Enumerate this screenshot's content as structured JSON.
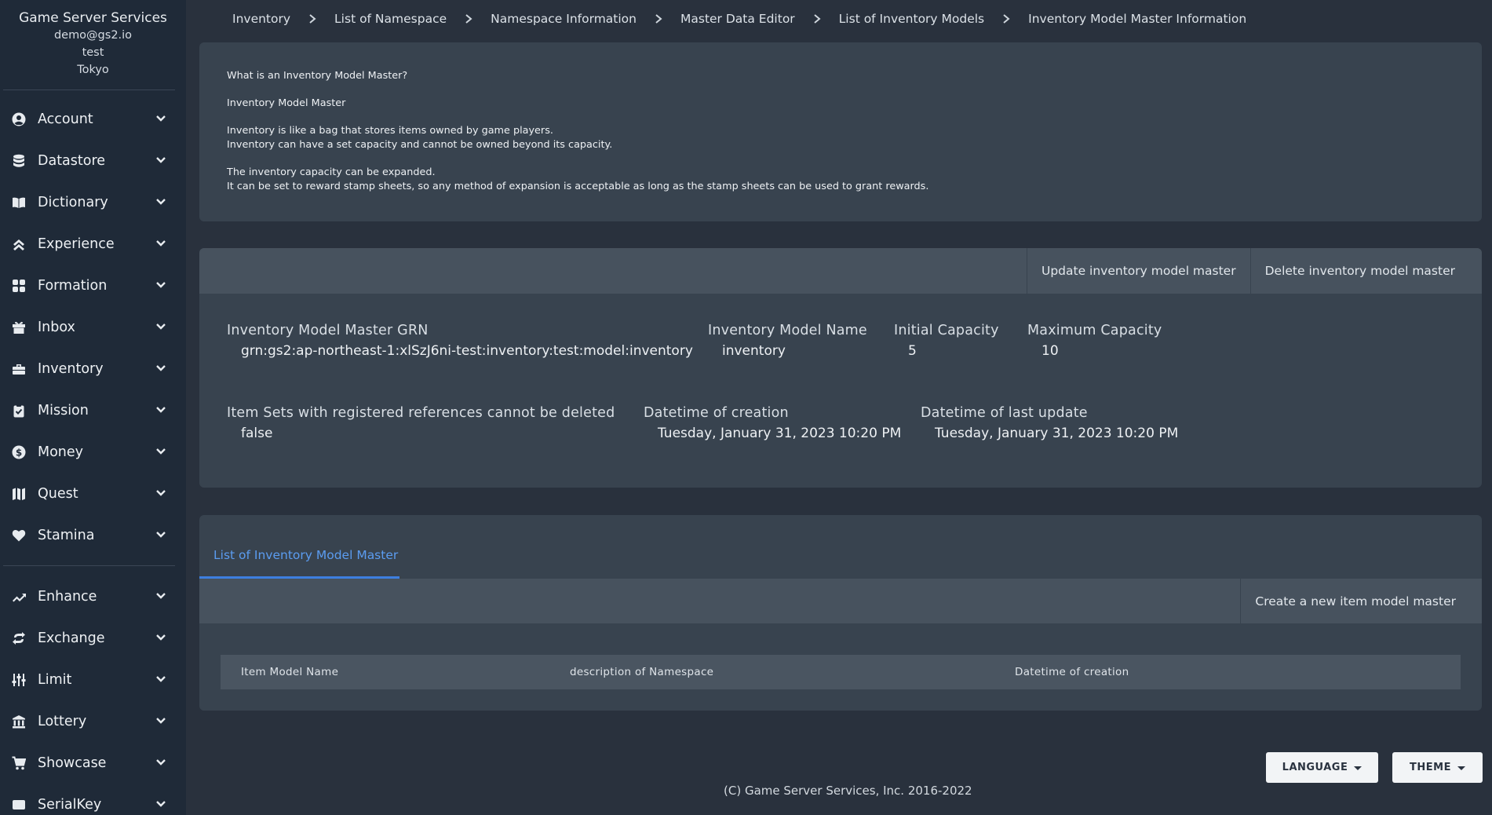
{
  "sidebar": {
    "brand": "Game Server Services",
    "user_email": "demo@gs2.io",
    "project": "test",
    "region": "Tokyo",
    "group1": [
      {
        "label": "Account",
        "icon": "account-circle-icon"
      },
      {
        "label": "Datastore",
        "icon": "database-icon"
      },
      {
        "label": "Dictionary",
        "icon": "book-open-icon"
      },
      {
        "label": "Experience",
        "icon": "double-chevron-up-icon"
      },
      {
        "label": "Formation",
        "icon": "grid-icon"
      },
      {
        "label": "Inbox",
        "icon": "gift-icon"
      },
      {
        "label": "Inventory",
        "icon": "toolbox-icon"
      },
      {
        "label": "Mission",
        "icon": "clipboard-check-icon"
      },
      {
        "label": "Money",
        "icon": "dollar-circle-icon"
      },
      {
        "label": "Quest",
        "icon": "map-icon"
      },
      {
        "label": "Stamina",
        "icon": "heart-icon"
      }
    ],
    "group2": [
      {
        "label": "Enhance",
        "icon": "trending-up-icon"
      },
      {
        "label": "Exchange",
        "icon": "exchange-icon"
      },
      {
        "label": "Limit",
        "icon": "sliders-icon"
      },
      {
        "label": "Lottery",
        "icon": "bank-icon"
      },
      {
        "label": "Showcase",
        "icon": "cart-icon"
      },
      {
        "label": "SerialKey",
        "icon": "key-card-icon"
      }
    ]
  },
  "breadcrumb": [
    "Inventory",
    "List of Namespace",
    "Namespace Information",
    "Master Data Editor",
    "List of Inventory Models",
    "Inventory Model Master Information"
  ],
  "description": {
    "question": "What is an Inventory Model Master?",
    "heading": "Inventory Model Master",
    "line1": "Inventory is like a bag that stores items owned by game players.",
    "line2": "Inventory can have a set capacity and cannot be owned beyond its capacity.",
    "line3": "The inventory capacity can be expanded.",
    "line4": "It can be set to reward stamp sheets, so any method of expansion is acceptable as long as the stamp sheets can be used to grant rewards."
  },
  "info": {
    "update_button": "Update inventory model master",
    "delete_button": "Delete inventory model master",
    "grn_label": "Inventory Model Master GRN",
    "grn_value": "grn:gs2:ap-northeast-1:xlSzJ6ni-test:inventory:test:model:inventory",
    "name_label": "Inventory Model Name",
    "name_value": "inventory",
    "initial_label": "Initial Capacity",
    "initial_value": "5",
    "max_label": "Maximum Capacity",
    "max_value": "10",
    "protect_label": "Item Sets with registered references cannot be deleted",
    "protect_value": "false",
    "created_label": "Datetime of creation",
    "created_value": "Tuesday, January 31, 2023 10:20 PM",
    "updated_label": "Datetime of last update",
    "updated_value": "Tuesday, January 31, 2023 10:20 PM"
  },
  "list": {
    "tab_label": "List of Inventory Model Master",
    "create_button": "Create a new item model master",
    "columns": [
      "Item Model Name",
      "description of Namespace",
      "Datetime of creation"
    ]
  },
  "footer": {
    "language": "LANGUAGE",
    "theme": "THEME",
    "copyright": "(C) Game Server Services, Inc. 2016-2022"
  }
}
